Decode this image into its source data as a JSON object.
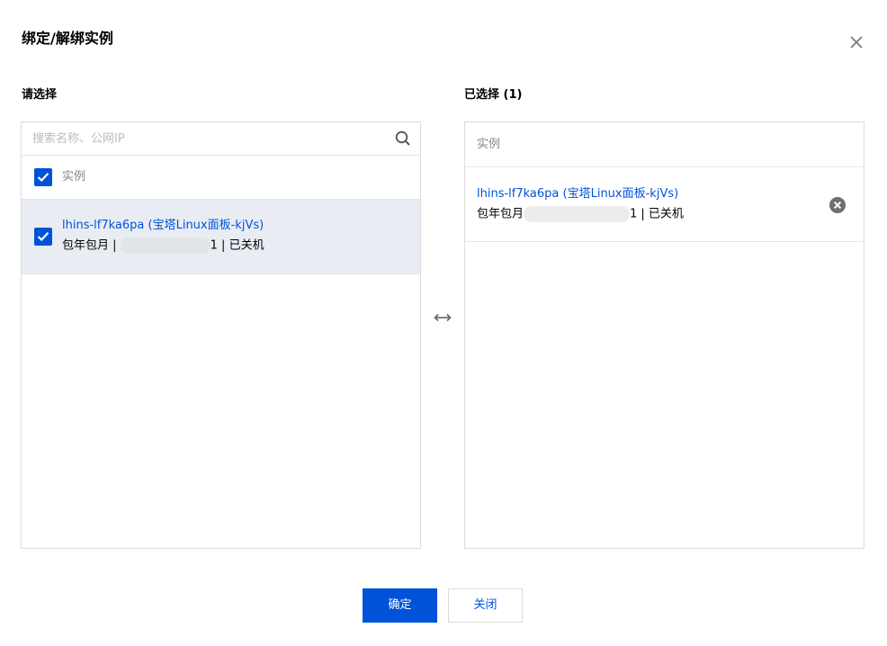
{
  "dialog": {
    "title": "绑定/解绑实例",
    "colors": {
      "accent": "#0052d9",
      "selected_row_bg": "#e9edf3",
      "border": "#dcdcdc"
    }
  },
  "left": {
    "label": "请选择",
    "search_placeholder": "搜索名称、公网IP",
    "column_header": "实例",
    "header_checked": true,
    "items": [
      {
        "name": "lhins-lf7ka6pa (宝塔Linux面板-kjVs)",
        "billing": "包年包月 | ",
        "status_suffix": "1 | 已关机",
        "checked": true,
        "selected": true
      }
    ]
  },
  "right": {
    "label": "已选择 (1)",
    "column_header": "实例",
    "items": [
      {
        "name": "lhins-lf7ka6pa (宝塔Linux面板-kjVs)",
        "billing": "包年包月",
        "status_suffix": "1 | 已关机",
        "remove_icon": "remove-circle-icon"
      }
    ]
  },
  "buttons": {
    "confirm": "确定",
    "close": "关闭"
  },
  "icons": {
    "close": "close-icon",
    "search": "search-icon",
    "swap": "swap-icon",
    "check": "check-icon"
  }
}
